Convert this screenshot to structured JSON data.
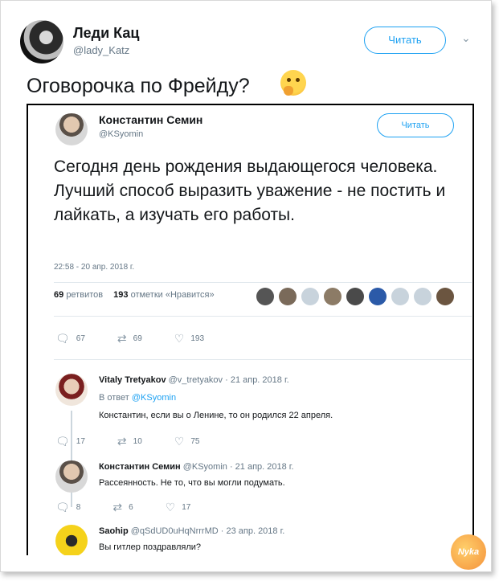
{
  "outer": {
    "name": "Леди Кац",
    "handle": "@lady_Katz",
    "follow_label": "Читать",
    "text": "Оговорочка по Фрейду?"
  },
  "tweet": {
    "name": "Константин Семин",
    "handle": "@KSyomin",
    "follow_label": "Читать",
    "text": "Сегодня день рождения выдающегося человека. Лучший способ выразить уважение - не постить и лайкать, а изучать его работы.",
    "time": "22:58 - 20 апр. 2018 г.",
    "retweets_count": "69",
    "retweets_label": "ретвитов",
    "likes_count": "193",
    "likes_label": "отметки «Нравится»",
    "actions": {
      "replies": "67",
      "retweets": "69",
      "likes": "193"
    }
  },
  "replies": [
    {
      "name": "Vitaly Tretyakov",
      "meta": "@v_tretyakov · 21 апр. 2018 г.",
      "reply_to_label": "В ответ",
      "reply_to_handle": "@KSyomin",
      "text": "Константин, если вы о Ленине, то он родился 22 апреля.",
      "actions": {
        "replies": "17",
        "retweets": "10",
        "likes": "75"
      }
    },
    {
      "name": "Константин Семин",
      "meta": "@KSyomin · 21 апр. 2018 г.",
      "text": "Рассеянность. Не то, что вы могли подумать.",
      "actions": {
        "replies": "8",
        "retweets": "6",
        "likes": "17"
      }
    },
    {
      "name": "Saohip",
      "meta": "@qSdUD0uHqNrrrMD · 23 апр. 2018 г.",
      "text": "Вы гитлер поздравляли?"
    }
  ],
  "icons": {
    "reply": "reply-icon",
    "retweet": "retweet-icon",
    "like": "heart-icon",
    "chevron": "chevron-down-icon"
  },
  "colors": {
    "accent": "#1da1f2",
    "muted": "#657786"
  },
  "watermark": "Nyka"
}
